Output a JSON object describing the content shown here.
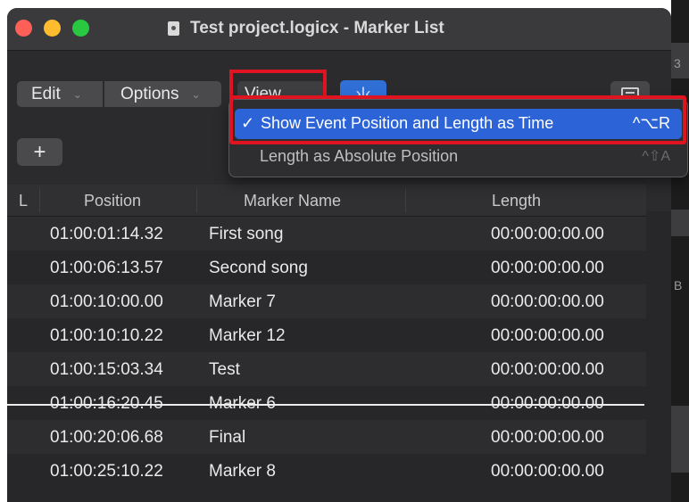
{
  "window": {
    "title": "Test project.logicx - Marker List"
  },
  "toolbar": {
    "edit_label": "Edit",
    "options_label": "Options",
    "view_label": "View",
    "add_label": "+"
  },
  "table": {
    "headers": {
      "lock": "L",
      "position": "Position",
      "name": "Marker Name",
      "length": "Length"
    },
    "rows": [
      {
        "position": "01:00:01:14.32",
        "name": "First song",
        "length": "00:00:00:00.00"
      },
      {
        "position": "01:00:06:13.57",
        "name": "Second song",
        "length": "00:00:00:00.00"
      },
      {
        "position": "01:00:10:00.00",
        "name": "Marker 7",
        "length": "00:00:00:00.00"
      },
      {
        "position": "01:00:10:10.22",
        "name": "Marker 12",
        "length": "00:00:00:00.00"
      },
      {
        "position": "01:00:15:03.34",
        "name": "Test",
        "length": "00:00:00:00.00"
      },
      {
        "position": "01:00:16:20.45",
        "name": "Marker 6",
        "length": "00:00:00:00.00"
      },
      {
        "position": "01:00:20:06.68",
        "name": "Final",
        "length": "00:00:00:00.00"
      },
      {
        "position": "01:00:25:10.22",
        "name": "Marker 8",
        "length": "00:00:00:00.00"
      }
    ]
  },
  "view_menu": {
    "items": [
      {
        "check": "✓",
        "label": "Show Event Position and Length as Time",
        "shortcut": "^⌥R"
      },
      {
        "check": "",
        "label": "Length as Absolute Position",
        "shortcut": "^⇧A"
      }
    ]
  },
  "right_edge": {
    "chars": [
      "3",
      "B"
    ]
  },
  "colors": {
    "highlight": "#2c64d8",
    "annotation": "#e01320",
    "window_bg": "#272729"
  }
}
